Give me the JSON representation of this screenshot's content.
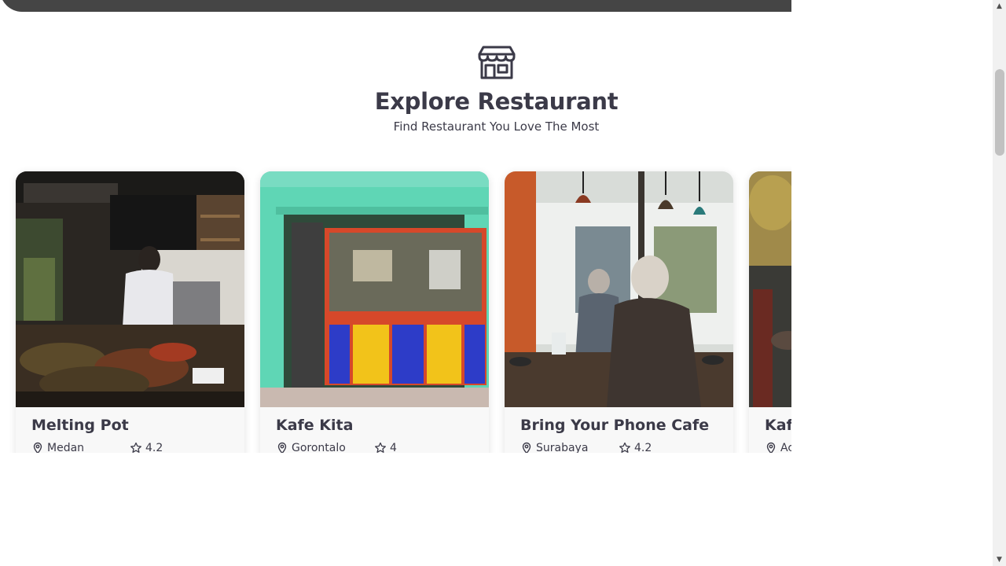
{
  "section": {
    "icon": "store-icon",
    "title": "Explore Restaurant",
    "subtitle": "Find Restaurant You Love The Most"
  },
  "restaurants": [
    {
      "name": "Melting Pot",
      "city": "Medan",
      "rating": "4.2",
      "image": "kitchen-counter-photo"
    },
    {
      "name": "Kafe Kita",
      "city": "Gorontalo",
      "rating": "4",
      "image": "colorful-storefront-photo"
    },
    {
      "name": "Bring Your Phone Cafe",
      "city": "Surabaya",
      "rating": "4.2",
      "image": "cafe-interior-photo"
    },
    {
      "name": "Kafe",
      "city": "Ac",
      "rating": "",
      "image": "outdoor-patio-photo"
    }
  ],
  "icons": {
    "location": "location-pin-icon",
    "rating": "star-icon"
  },
  "colors": {
    "text": "#3b3a48",
    "hero_bar": "#454545",
    "card_bg": "#f8f8f8"
  }
}
